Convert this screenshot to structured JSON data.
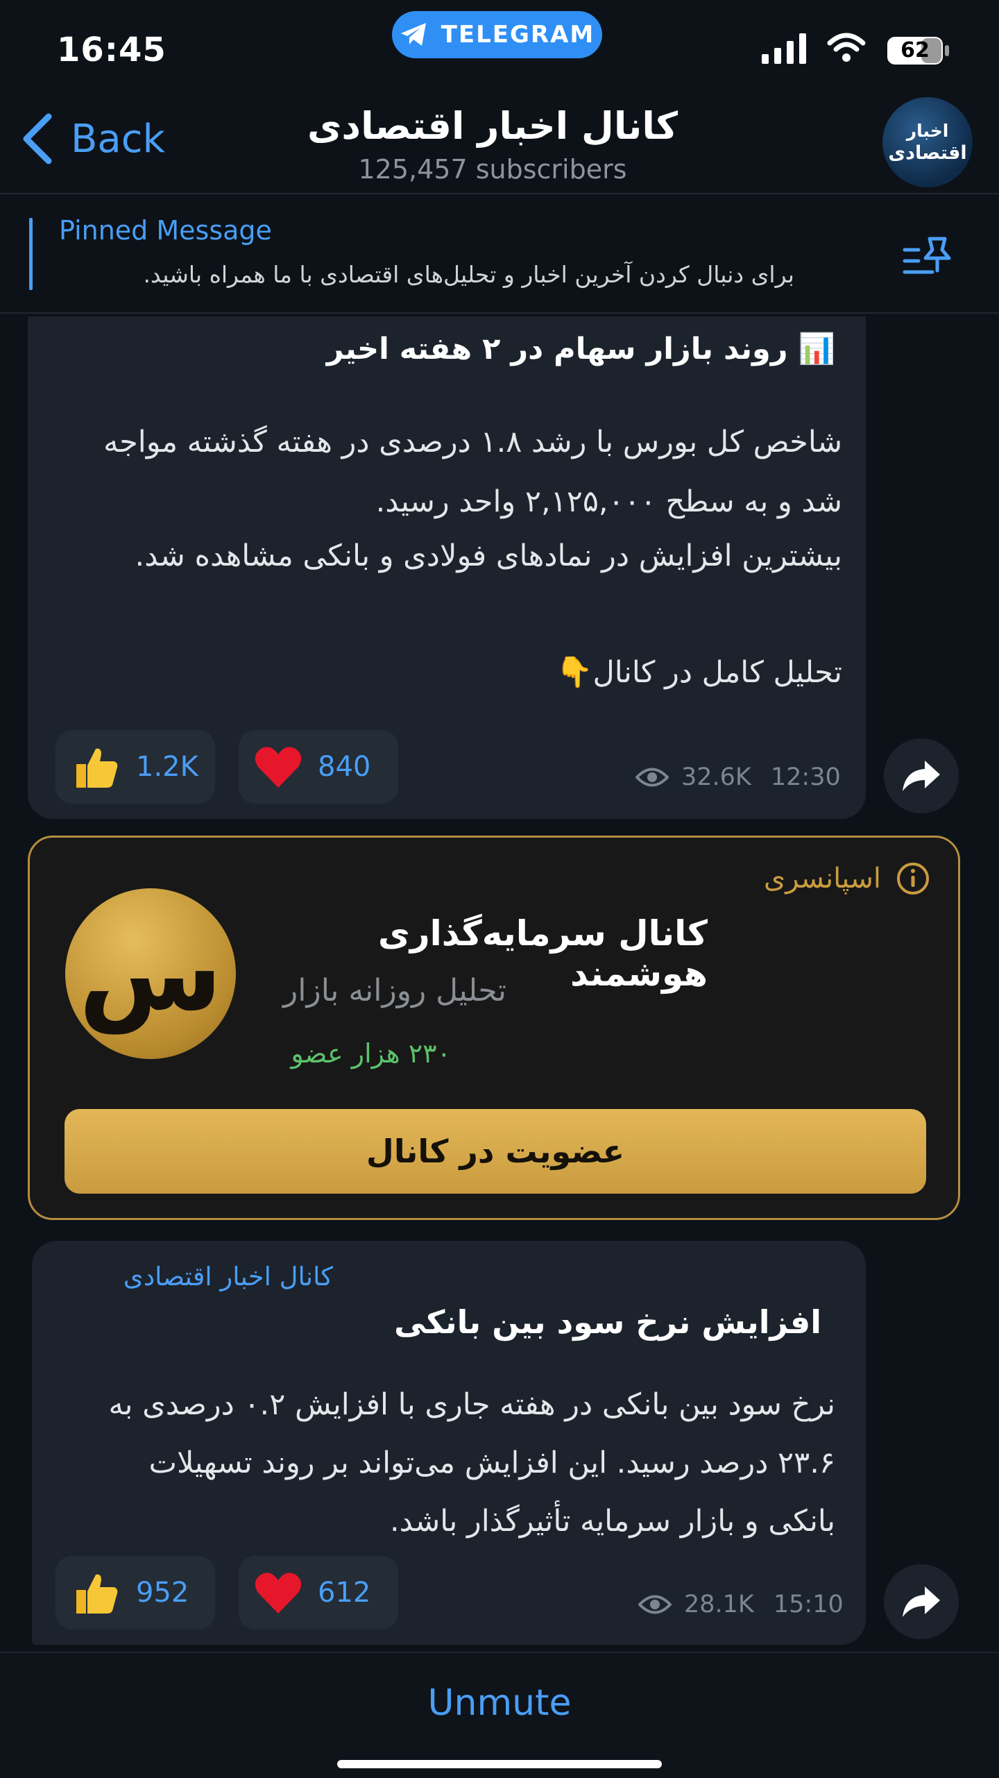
{
  "status_bar": {
    "time": "16:45",
    "telegram_pill": "TELEGRAM",
    "battery": "62"
  },
  "header": {
    "back_label": "Back",
    "title": "کانال اخبار اقتصادی",
    "subscribers": "125,457 subscribers",
    "avatar_line1": "اخبار",
    "avatar_line2": "اقتصادی"
  },
  "pinned": {
    "label": "Pinned Message",
    "text": "برای دنبال کردن آخرین اخبار و تحلیل‌های اقتصادی با ما همراه باشید."
  },
  "message1": {
    "title_emoji": "📊",
    "title": "روند بازار سهام در ۲ هفته اخیر",
    "para1": "شاخص کل بورس با رشد ۱.۸ درصدی در هفته گذشته مواجه شد و به سطح ۲,۱۲۵,۰۰۰ واحد رسید.",
    "para2": "بیشترین افزایش در نمادهای فولادی و بانکی مشاهده شد.",
    "cta": "تحلیل کامل در کانال",
    "cta_emoji": "👇",
    "reactions": [
      {
        "icon": "thumbs-up-icon",
        "count": "1.2K"
      },
      {
        "icon": "heart-icon",
        "count": "840"
      }
    ],
    "views": "32.6K",
    "time": "12:30"
  },
  "sponsored": {
    "label": "اسپانسری",
    "coin_letter": "س",
    "channel_name": "کانال سرمایه‌گذاری هوشمند",
    "description": "تحلیل روزانه بازار",
    "members": "۲۳۰ هزار عضو",
    "join_label": "عضویت در کانال",
    "accent_color": "#c99c3f",
    "members_color": "#5cc26a"
  },
  "message2": {
    "author": "کانال اخبار اقتصادی",
    "title": "افزایش نرخ سود بین بانکی",
    "body": "نرخ سود بین بانکی در هفته جاری با افزایش ۰.۲ درصدی به ۲۳.۶ درصد رسید. این افزایش می‌تواند بر روند تسهیلات بانکی و بازار سرمایه تأثیرگذار باشد.",
    "reactions": [
      {
        "icon": "thumbs-up-icon",
        "count": "952"
      },
      {
        "icon": "heart-icon",
        "count": "612"
      }
    ],
    "views": "28.1K",
    "time": "15:10"
  },
  "bottom": {
    "unmute_label": "Unmute"
  }
}
